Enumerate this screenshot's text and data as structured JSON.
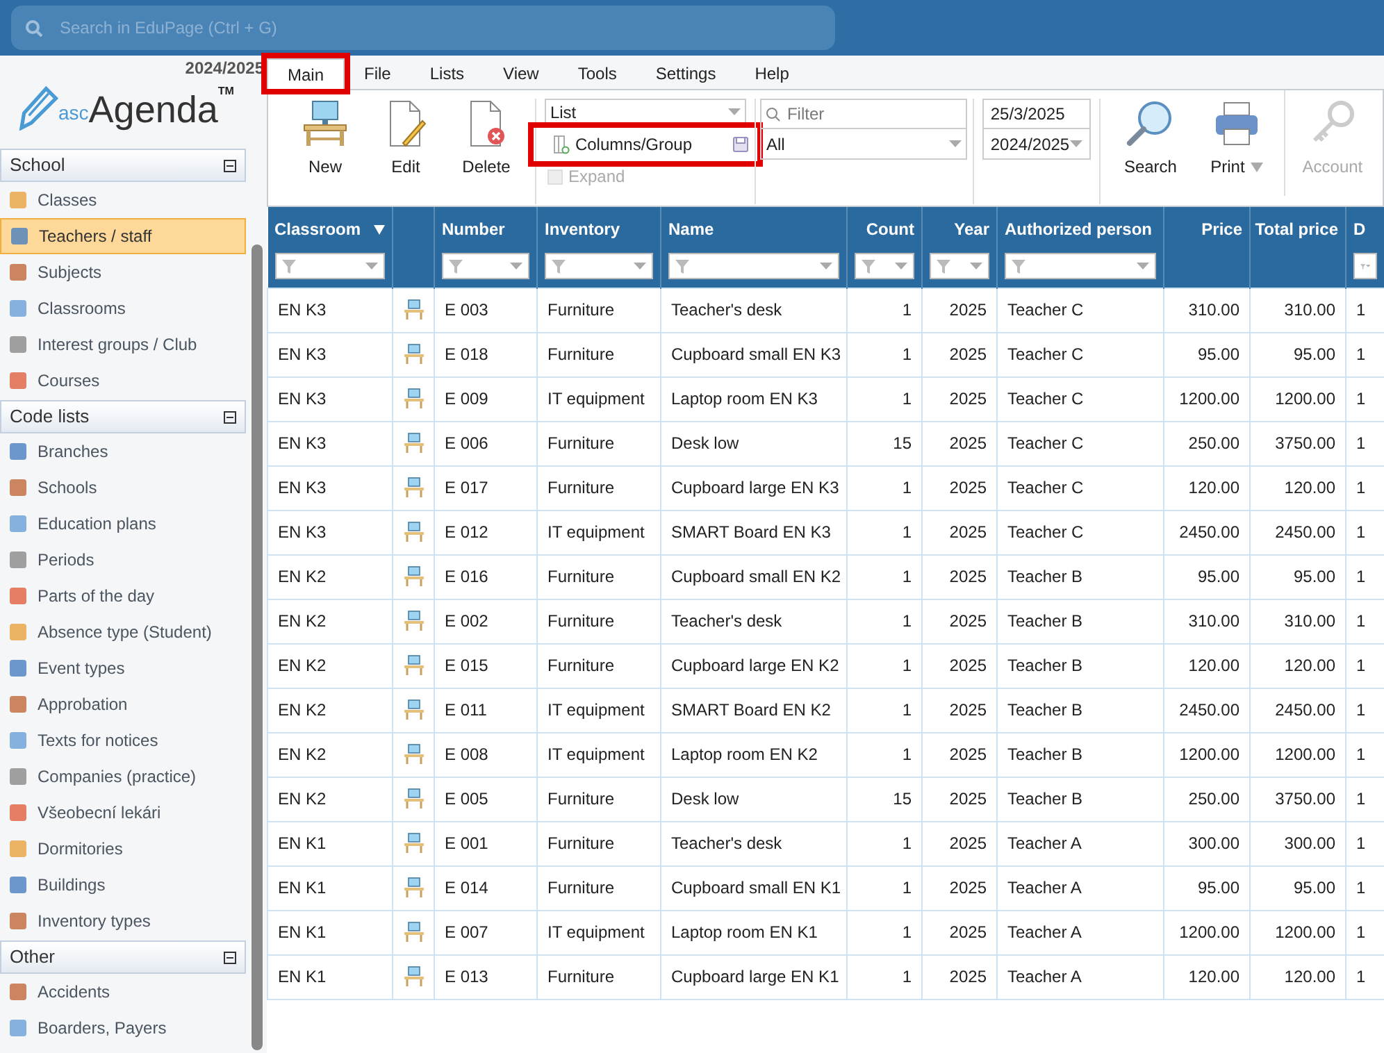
{
  "search": {
    "placeholder": "Search in EduPage (Ctrl + G)"
  },
  "logo": {
    "year": "2024/2025",
    "prefix": "asc",
    "name": "Agenda",
    "mark": "TM"
  },
  "menu": [
    {
      "label": "Main",
      "selected": true,
      "highlighted": true
    },
    {
      "label": "File",
      "selected": false,
      "highlighted": false
    },
    {
      "label": "Lists",
      "selected": false,
      "highlighted": false
    },
    {
      "label": "View",
      "selected": false,
      "highlighted": false
    },
    {
      "label": "Tools",
      "selected": false,
      "highlighted": false
    },
    {
      "label": "Settings",
      "selected": false,
      "highlighted": false
    },
    {
      "label": "Help",
      "selected": false,
      "highlighted": false
    }
  ],
  "toolbar": {
    "actions": [
      {
        "label": "New",
        "kind": "new"
      },
      {
        "label": "Edit",
        "kind": "edit"
      },
      {
        "label": "Delete",
        "kind": "delete"
      }
    ],
    "view_select": "List",
    "columns_button": {
      "label": "Columns/Group",
      "highlighted": true
    },
    "expand": {
      "label": "Expand",
      "checked": false,
      "disabled": true
    },
    "filter": {
      "placeholder": "Filter"
    },
    "filter_select": "All",
    "date": "25/3/2025",
    "year_select": "2024/2025",
    "tools": [
      {
        "label": "Search",
        "kind": "search",
        "disabled": false
      },
      {
        "label": "Print",
        "kind": "print",
        "disabled": false
      },
      {
        "label": "Account",
        "kind": "account",
        "disabled": true
      }
    ]
  },
  "sidebar": [
    {
      "title": "School",
      "expanded": true,
      "items": [
        {
          "label": "Classes",
          "selected": false
        },
        {
          "label": "Teachers / staff",
          "selected": true
        },
        {
          "label": "Subjects",
          "selected": false
        },
        {
          "label": "Classrooms",
          "selected": false
        },
        {
          "label": "Interest groups / Club",
          "selected": false
        },
        {
          "label": "Courses",
          "selected": false
        }
      ]
    },
    {
      "title": "Code lists",
      "expanded": true,
      "items": [
        {
          "label": "Branches",
          "selected": false
        },
        {
          "label": "Schools",
          "selected": false
        },
        {
          "label": "Education plans",
          "selected": false
        },
        {
          "label": "Periods",
          "selected": false
        },
        {
          "label": "Parts of the day",
          "selected": false
        },
        {
          "label": "Absence type (Student)",
          "selected": false
        },
        {
          "label": "Event types",
          "selected": false
        },
        {
          "label": "Approbation",
          "selected": false
        },
        {
          "label": "Texts for notices",
          "selected": false
        },
        {
          "label": "Companies (practice)",
          "selected": false
        },
        {
          "label": "Všeobecní lekári",
          "selected": false
        },
        {
          "label": "Dormitories",
          "selected": false
        },
        {
          "label": "Buildings",
          "selected": false
        },
        {
          "label": "Inventory types",
          "selected": false
        }
      ]
    },
    {
      "title": "Other",
      "expanded": true,
      "items": [
        {
          "label": "Accidents",
          "selected": false
        },
        {
          "label": "Boarders, Payers",
          "selected": false
        }
      ]
    }
  ],
  "table": {
    "columns": [
      {
        "label": "Classroom",
        "filter": true,
        "sorted": true
      },
      {
        "filter": false,
        "sorted": false
      },
      {
        "label": "Number",
        "filter": true,
        "sorted": false
      },
      {
        "label": "Inventory",
        "filter": true,
        "sorted": false
      },
      {
        "label": "Name",
        "filter": true,
        "sorted": false
      },
      {
        "label": "Count",
        "filter": true,
        "sorted": false
      },
      {
        "label": "Year",
        "filter": true,
        "sorted": false
      },
      {
        "label": "Authorized person",
        "filter": true,
        "sorted": false
      },
      {
        "label": "Price",
        "filter": false,
        "sorted": false
      },
      {
        "label": "Total price",
        "filter": false,
        "sorted": false
      },
      {
        "label": "D",
        "filter": true,
        "sorted": false
      }
    ],
    "rows": [
      [
        "EN K3",
        "",
        "E 003",
        "Furniture",
        "Teacher's desk",
        "1",
        "2025",
        "Teacher C",
        "310.00",
        "310.00",
        "1"
      ],
      [
        "EN K3",
        "",
        "E 018",
        "Furniture",
        "Cupboard small EN K3",
        "1",
        "2025",
        "Teacher C",
        "95.00",
        "95.00",
        "1"
      ],
      [
        "EN K3",
        "",
        "E 009",
        "IT equipment",
        "Laptop room EN K3",
        "1",
        "2025",
        "Teacher C",
        "1200.00",
        "1200.00",
        "1"
      ],
      [
        "EN K3",
        "",
        "E 006",
        "Furniture",
        "Desk low",
        "15",
        "2025",
        "Teacher C",
        "250.00",
        "3750.00",
        "1"
      ],
      [
        "EN K3",
        "",
        "E 017",
        "Furniture",
        "Cupboard large EN K3",
        "1",
        "2025",
        "Teacher C",
        "120.00",
        "120.00",
        "1"
      ],
      [
        "EN K3",
        "",
        "E 012",
        "IT equipment",
        "SMART Board EN K3",
        "1",
        "2025",
        "Teacher C",
        "2450.00",
        "2450.00",
        "1"
      ],
      [
        "EN K2",
        "",
        "E 016",
        "Furniture",
        "Cupboard small EN K2",
        "1",
        "2025",
        "Teacher B",
        "95.00",
        "95.00",
        "1"
      ],
      [
        "EN K2",
        "",
        "E 002",
        "Furniture",
        "Teacher's desk",
        "1",
        "2025",
        "Teacher B",
        "310.00",
        "310.00",
        "1"
      ],
      [
        "EN K2",
        "",
        "E 015",
        "Furniture",
        "Cupboard large EN K2",
        "1",
        "2025",
        "Teacher B",
        "120.00",
        "120.00",
        "1"
      ],
      [
        "EN K2",
        "",
        "E 011",
        "IT equipment",
        "SMART Board EN K2",
        "1",
        "2025",
        "Teacher B",
        "2450.00",
        "2450.00",
        "1"
      ],
      [
        "EN K2",
        "",
        "E 008",
        "IT equipment",
        "Laptop room EN K2",
        "1",
        "2025",
        "Teacher B",
        "1200.00",
        "1200.00",
        "1"
      ],
      [
        "EN K2",
        "",
        "E 005",
        "Furniture",
        "Desk low",
        "15",
        "2025",
        "Teacher B",
        "250.00",
        "3750.00",
        "1"
      ],
      [
        "EN K1",
        "",
        "E 001",
        "Furniture",
        "Teacher's desk",
        "1",
        "2025",
        "Teacher A",
        "300.00",
        "300.00",
        "1"
      ],
      [
        "EN K1",
        "",
        "E 014",
        "Furniture",
        "Cupboard small EN K1",
        "1",
        "2025",
        "Teacher A",
        "95.00",
        "95.00",
        "1"
      ],
      [
        "EN K1",
        "",
        "E 007",
        "IT equipment",
        "Laptop room EN K1",
        "1",
        "2025",
        "Teacher A",
        "1200.00",
        "1200.00",
        "1"
      ],
      [
        "EN K1",
        "",
        "E 013",
        "Furniture",
        "Cupboard large EN K1",
        "1",
        "2025",
        "Teacher A",
        "120.00",
        "120.00",
        "1"
      ]
    ]
  }
}
